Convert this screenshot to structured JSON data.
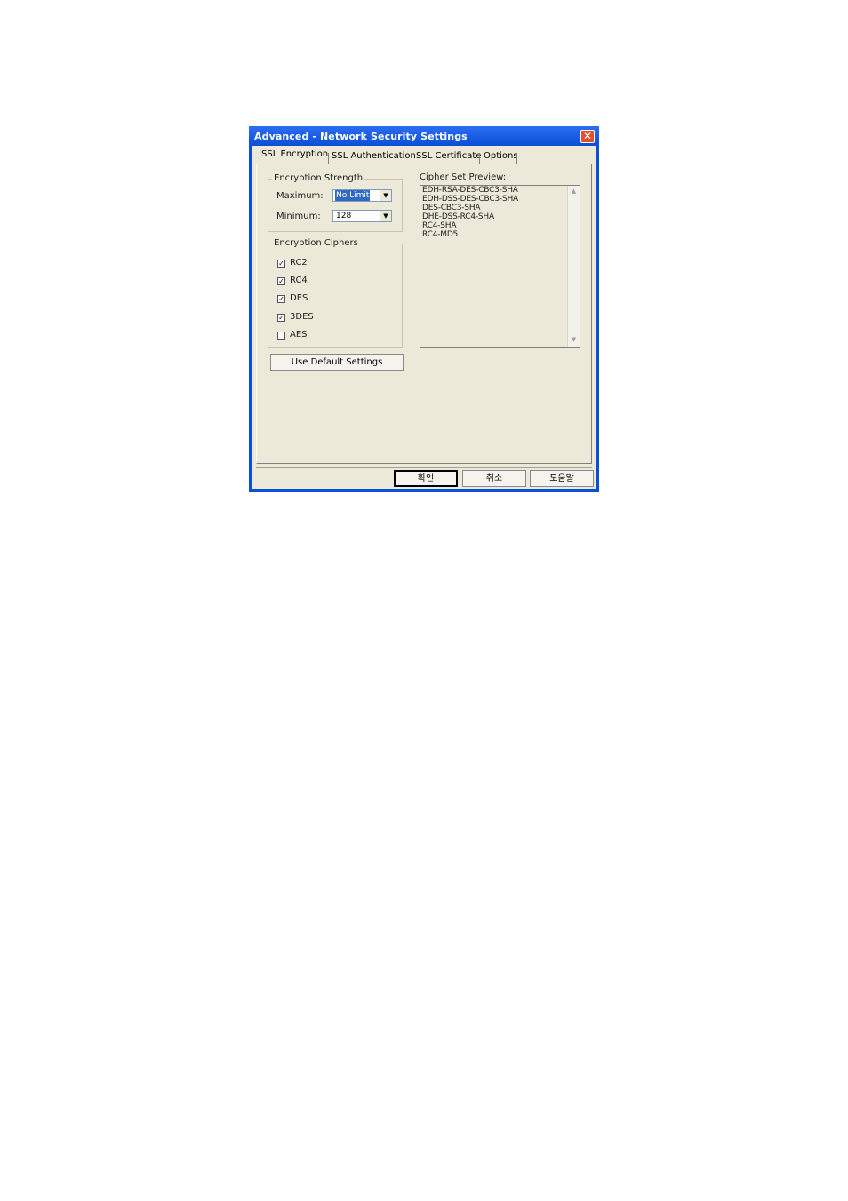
{
  "window": {
    "title": "Advanced - Network Security Settings",
    "close_glyph": "✕"
  },
  "tabs": [
    {
      "label": "SSL Encryption",
      "active": true
    },
    {
      "label": "SSL Authentication",
      "active": false
    },
    {
      "label": "SSL Certificate",
      "active": false
    },
    {
      "label": "Options",
      "active": false
    }
  ],
  "encryption_strength": {
    "legend": "Encryption Strength",
    "maximum_label": "Maximum:",
    "maximum_value": "No Limit",
    "minimum_label": "Minimum:",
    "minimum_value": "128"
  },
  "encryption_ciphers": {
    "legend": "Encryption Ciphers",
    "items": [
      {
        "label": "RC2",
        "checked": true
      },
      {
        "label": "RC4",
        "checked": true
      },
      {
        "label": "DES",
        "checked": true
      },
      {
        "label": "3DES",
        "checked": true
      },
      {
        "label": "AES",
        "checked": false
      }
    ]
  },
  "use_default_label": "Use Default Settings",
  "cipher_preview": {
    "label": "Cipher Set Preview:",
    "lines": [
      "EDH-RSA-DES-CBC3-SHA",
      "EDH-DSS-DES-CBC3-SHA",
      "DES-CBC3-SHA",
      "DHE-DSS-RC4-SHA",
      "RC4-SHA",
      "RC4-MD5"
    ]
  },
  "buttons": {
    "ok": "확인",
    "cancel": "취소",
    "help": "도움말"
  },
  "glyphs": {
    "check": "✓",
    "dropdown": "▼",
    "scroll_up": "▲",
    "scroll_down": "▼"
  },
  "colors": {
    "titlebar": "#0a50d8",
    "dialog_bg": "#ece9d8",
    "selection": "#316ac5",
    "close_button": "#e0502e"
  }
}
